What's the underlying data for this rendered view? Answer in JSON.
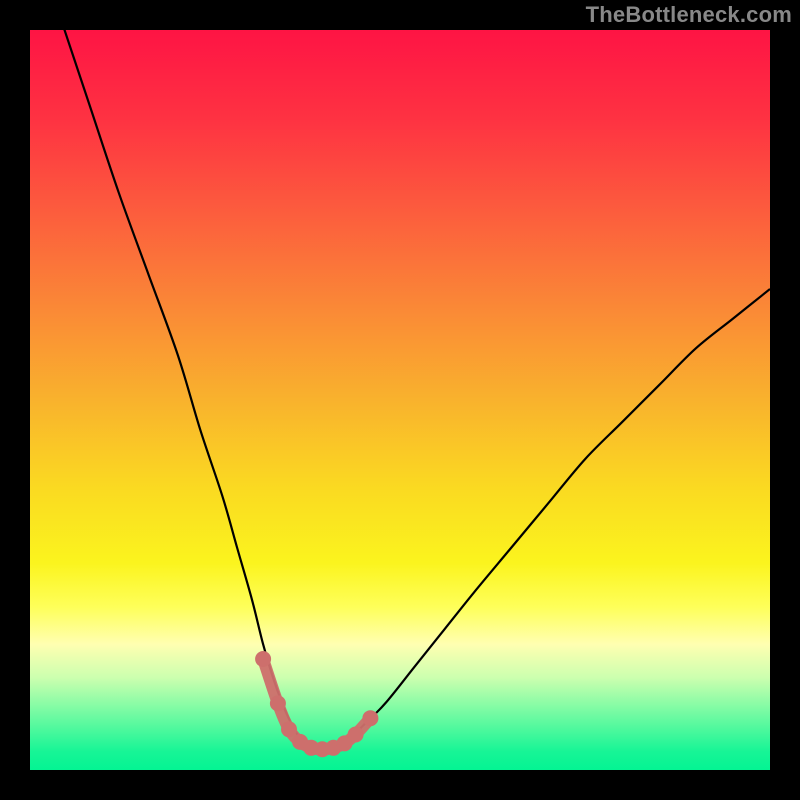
{
  "watermark": "TheBottleneck.com",
  "colors": {
    "background": "#000000",
    "curve": "#000000",
    "marker_fill": "#cd6f6c",
    "marker_stroke": "#cd6f6c",
    "gradient_stops": [
      {
        "offset": 0.0,
        "color": "#fe1444"
      },
      {
        "offset": 0.12,
        "color": "#fe3242"
      },
      {
        "offset": 0.25,
        "color": "#fc5e3d"
      },
      {
        "offset": 0.38,
        "color": "#fa8a36"
      },
      {
        "offset": 0.5,
        "color": "#f9b22d"
      },
      {
        "offset": 0.62,
        "color": "#fada21"
      },
      {
        "offset": 0.72,
        "color": "#fbf41e"
      },
      {
        "offset": 0.78,
        "color": "#feff5a"
      },
      {
        "offset": 0.83,
        "color": "#ffffb1"
      },
      {
        "offset": 0.875,
        "color": "#ccffaf"
      },
      {
        "offset": 0.91,
        "color": "#8cfca6"
      },
      {
        "offset": 0.945,
        "color": "#4df89d"
      },
      {
        "offset": 0.975,
        "color": "#17f596"
      },
      {
        "offset": 1.0,
        "color": "#04f493"
      }
    ]
  },
  "chart_data": {
    "type": "line",
    "title": "",
    "xlabel": "",
    "ylabel": "",
    "xlim": [
      0,
      100
    ],
    "ylim": [
      0,
      100
    ],
    "grid": false,
    "series": [
      {
        "name": "bottleneck-curve",
        "x": [
          4,
          8,
          12,
          16,
          20,
          23,
          26,
          28,
          30,
          31.5,
          33,
          34.5,
          36,
          37,
          38,
          39,
          40,
          41.5,
          43,
          45,
          48,
          52,
          56,
          60,
          65,
          70,
          75,
          80,
          85,
          90,
          95,
          100
        ],
        "values": [
          102,
          90,
          78,
          67,
          56,
          46,
          37,
          30,
          23,
          17,
          12,
          8,
          5,
          3.5,
          2.8,
          2.5,
          2.6,
          3,
          4,
          6,
          9,
          14,
          19,
          24,
          30,
          36,
          42,
          47,
          52,
          57,
          61,
          65
        ]
      }
    ],
    "markers": {
      "name": "highlighted-points",
      "x": [
        31.5,
        33.5,
        35,
        36.5,
        38,
        39.5,
        41,
        42.5,
        44,
        46
      ],
      "values": [
        15,
        9,
        5.5,
        3.8,
        3,
        2.8,
        3,
        3.6,
        4.8,
        7
      ],
      "radius": 8
    }
  }
}
